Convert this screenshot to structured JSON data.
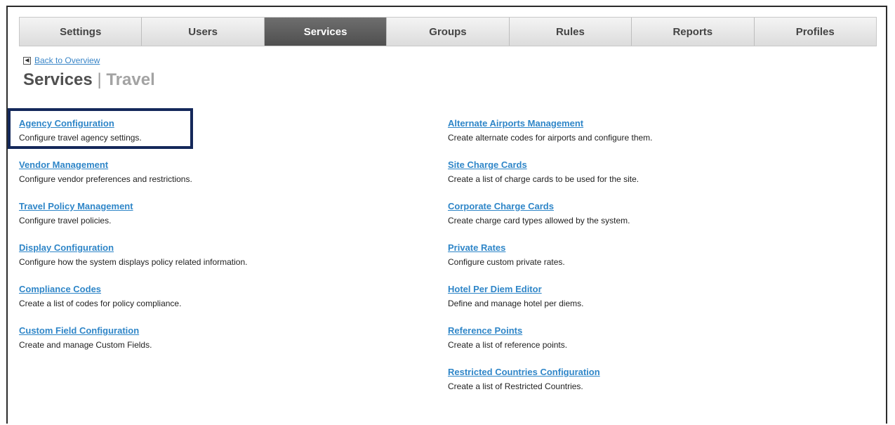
{
  "tabs": [
    {
      "label": "Settings",
      "active": false
    },
    {
      "label": "Users",
      "active": false
    },
    {
      "label": "Services",
      "active": true
    },
    {
      "label": "Groups",
      "active": false
    },
    {
      "label": "Rules",
      "active": false
    },
    {
      "label": "Reports",
      "active": false
    },
    {
      "label": "Profiles",
      "active": false
    }
  ],
  "back_link": {
    "label": "Back to Overview",
    "icon": "back-arrow-icon"
  },
  "page_title": {
    "main": "Services",
    "separator": "|",
    "sub": "Travel"
  },
  "left_items": [
    {
      "title": "Agency Configuration",
      "desc": "Configure travel agency settings."
    },
    {
      "title": "Vendor Management",
      "desc": "Configure vendor preferences and restrictions."
    },
    {
      "title": "Travel Policy Management",
      "desc": "Configure travel policies."
    },
    {
      "title": "Display Configuration",
      "desc": "Configure how the system displays policy related information."
    },
    {
      "title": "Compliance Codes",
      "desc": "Create a list of codes for policy compliance."
    },
    {
      "title": "Custom Field Configuration",
      "desc": "Create and manage Custom Fields."
    }
  ],
  "right_items": [
    {
      "title": "Alternate Airports Management",
      "desc": "Create alternate codes for airports and configure them."
    },
    {
      "title": "Site Charge Cards",
      "desc": "Create a list of charge cards to be used for the site."
    },
    {
      "title": "Corporate Charge Cards",
      "desc": "Create charge card types allowed by the system."
    },
    {
      "title": "Private Rates",
      "desc": "Configure custom private rates."
    },
    {
      "title": "Hotel Per Diem Editor",
      "desc": "Define and manage hotel per diems."
    },
    {
      "title": "Reference Points",
      "desc": "Create a list of reference points."
    },
    {
      "title": "Restricted Countries Configuration",
      "desc": "Create a list of Restricted Countries."
    }
  ],
  "colors": {
    "accent": "#2f86c8",
    "active_tab": "#5a5a5a",
    "highlight": "#14285a"
  }
}
